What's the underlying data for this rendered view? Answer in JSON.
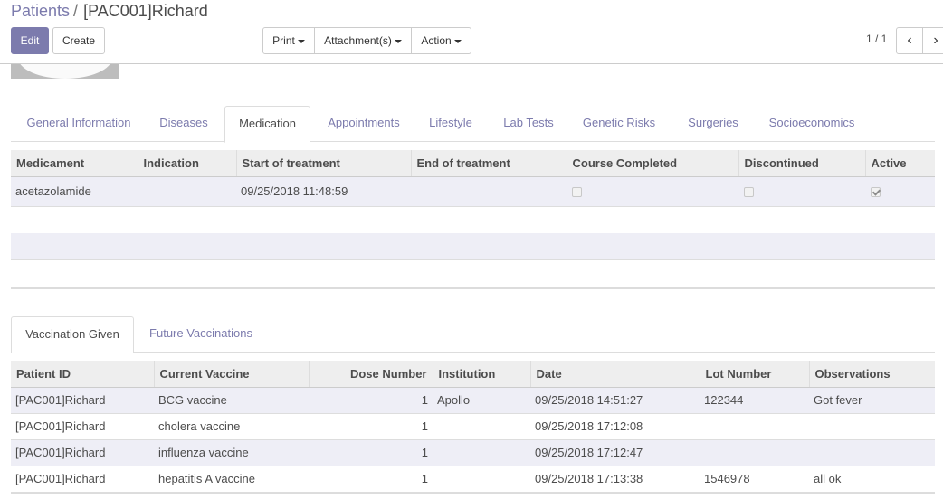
{
  "breadcrumb": {
    "parent": "Patients",
    "separator": "/",
    "current": "[PAC001]Richard"
  },
  "toolbar": {
    "edit": "Edit",
    "create": "Create",
    "print": "Print",
    "attachments": "Attachment(s)",
    "action": "Action"
  },
  "pager": {
    "value": "1 / 1",
    "prev": "‹",
    "next": "›"
  },
  "main_tabs": [
    {
      "label": "General Information"
    },
    {
      "label": "Diseases"
    },
    {
      "label": "Medication",
      "active": true
    },
    {
      "label": "Appointments"
    },
    {
      "label": "Lifestyle"
    },
    {
      "label": "Lab Tests"
    },
    {
      "label": "Genetic Risks"
    },
    {
      "label": "Surgeries"
    },
    {
      "label": "Socioeconomics"
    }
  ],
  "medication": {
    "columns": [
      "Medicament",
      "Indication",
      "Start of treatment",
      "End of treatment",
      "Course Completed",
      "Discontinued",
      "Active"
    ],
    "rows": [
      {
        "medicament": "acetazolamide",
        "indication": "",
        "start": "09/25/2018 11:48:59",
        "end": "",
        "course_completed": false,
        "discontinued": false,
        "active": true
      }
    ]
  },
  "vaccination_tabs": [
    {
      "label": "Vaccination Given",
      "active": true
    },
    {
      "label": "Future Vaccinations"
    }
  ],
  "vaccinations": {
    "columns": [
      "Patient ID",
      "Current Vaccine",
      "Dose Number",
      "Institution",
      "Date",
      "Lot Number",
      "Observations"
    ],
    "rows": [
      {
        "patient": "[PAC001]Richard",
        "vaccine": "BCG vaccine",
        "dose": "1",
        "institution": "Apollo",
        "date": "09/25/2018 14:51:27",
        "lot": "122344",
        "observations": "Got fever"
      },
      {
        "patient": "[PAC001]Richard",
        "vaccine": "cholera vaccine",
        "dose": "1",
        "institution": "",
        "date": "09/25/2018 17:12:08",
        "lot": "",
        "observations": ""
      },
      {
        "patient": "[PAC001]Richard",
        "vaccine": "influenza vaccine",
        "dose": "1",
        "institution": "",
        "date": "09/25/2018 17:12:47",
        "lot": "",
        "observations": ""
      },
      {
        "patient": "[PAC001]Richard",
        "vaccine": "hepatitis A vaccine",
        "dose": "1",
        "institution": "",
        "date": "09/25/2018 17:13:38",
        "lot": "1546978",
        "observations": "all ok"
      }
    ]
  },
  "colors": {
    "brand": "#7c7bad",
    "row_alt": "#eeeef6",
    "header_bg": "#eeeeee"
  }
}
